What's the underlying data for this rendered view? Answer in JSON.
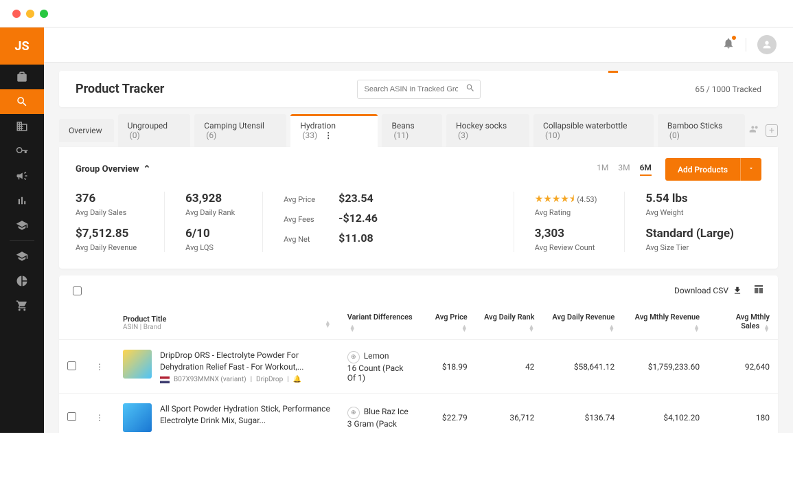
{
  "logo": "JS",
  "page_title": "Product Tracker",
  "search": {
    "placeholder": "Search ASIN in Tracked Groups"
  },
  "tracked": {
    "current": "65",
    "total": "1000",
    "suffix": "Tracked"
  },
  "tabs": [
    {
      "label": "Overview",
      "count": ""
    },
    {
      "label": "Ungrouped",
      "count": "(0)"
    },
    {
      "label": "Camping Utensil",
      "count": "(6)"
    },
    {
      "label": "Hydration",
      "count": "(33)"
    },
    {
      "label": "Beans",
      "count": "(11)"
    },
    {
      "label": "Hockey socks",
      "count": "(3)"
    },
    {
      "label": "Collapsible waterbottle",
      "count": "(10)"
    },
    {
      "label": "Bamboo Sticks",
      "count": "(0)"
    }
  ],
  "panel": {
    "title": "Group Overview",
    "time": {
      "opts": [
        "1M",
        "3M",
        "6M"
      ],
      "active": "6M"
    },
    "add_button": "Add Products"
  },
  "stats": {
    "daily_sales": {
      "value": "376",
      "label": "Avg Daily Sales"
    },
    "daily_revenue": {
      "value": "$7,512.85",
      "label": "Avg Daily Revenue"
    },
    "daily_rank": {
      "value": "63,928",
      "label": "Avg Daily Rank"
    },
    "lqs": {
      "value": "6/10",
      "label": "Avg LQS"
    },
    "price": {
      "label": "Avg Price",
      "value": "$23.54"
    },
    "fees": {
      "label": "Avg Fees",
      "value": "-$12.46"
    },
    "net": {
      "label": "Avg Net",
      "value": "$11.08"
    },
    "rating": {
      "stars": "★★★★⯨",
      "value": "(4.53)",
      "label": "Avg Rating"
    },
    "reviews": {
      "value": "3,303",
      "label": "Avg Review Count"
    },
    "weight": {
      "value": "5.54 lbs",
      "label": "Avg Weight"
    },
    "size": {
      "value": "Standard (Large)",
      "label": "Avg Size Tier"
    }
  },
  "table": {
    "download": "Download CSV",
    "headers": {
      "title": "Product Title",
      "title_sub": "ASIN | Brand",
      "variant": "Variant Differences",
      "price": "Avg Price",
      "rank": "Avg Daily Rank",
      "revenue": "Avg Daily Revenue",
      "mrev": "Avg Mthly Revenue",
      "msales": "Avg Mthly Sales"
    },
    "rows": [
      {
        "title": "DripDrop ORS - Electrolyte Powder For Dehydration Relief Fast - For Workout,...",
        "asin": "B07X93MMNX (variant)",
        "brand": "DripDrop",
        "variant": "Lemon\n16 Count (Pack Of 1)",
        "price": "$18.99",
        "rank": "42",
        "revenue": "$58,641.12",
        "mrev": "$1,759,233.60",
        "msales": "92,640"
      },
      {
        "title": "All Sport Powder Hydration Stick, Performance Electrolyte Drink Mix, Sugar...",
        "asin": "",
        "brand": "",
        "variant": "Blue Raz Ice\n3 Gram (Pack",
        "price": "$22.79",
        "rank": "36,712",
        "revenue": "$136.74",
        "mrev": "$4,102.20",
        "msales": "180"
      }
    ]
  }
}
